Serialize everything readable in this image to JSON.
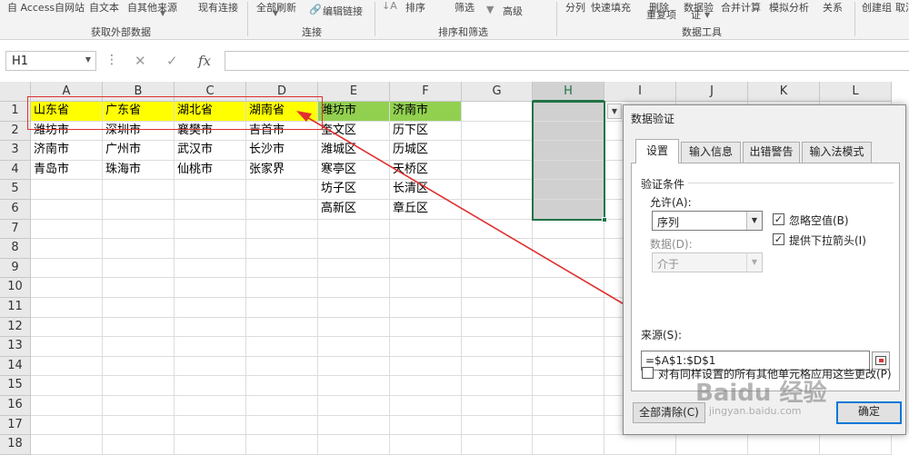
{
  "ribbon": {
    "top_items": [
      "自 Access",
      "自网站",
      "自文本",
      "自其他来源",
      "现有连接",
      "全部刷新",
      "编辑链接",
      "排序",
      "筛选",
      "高级",
      "分列",
      "快速填充",
      "删除",
      "数据验",
      "合并计算",
      "模拟分析",
      "关系",
      "创建组",
      "取消"
    ],
    "row2_items": [
      "重复项",
      "证"
    ],
    "groups": [
      "获取外部数据",
      "连接",
      "排序和筛选",
      "数据工具"
    ]
  },
  "formula_bar": {
    "name_box": "H1",
    "cancel_icon": "✕",
    "enter_icon": "✓",
    "fx_label": "fx",
    "value": ""
  },
  "sheet": {
    "columns": [
      "A",
      "B",
      "C",
      "D",
      "E",
      "F",
      "G",
      "H",
      "I",
      "J",
      "K",
      "L"
    ],
    "selected_column": "H",
    "rows": [
      "1",
      "2",
      "3",
      "4",
      "5",
      "6",
      "7",
      "8",
      "9",
      "10",
      "11",
      "12",
      "13",
      "14",
      "15",
      "16",
      "17",
      "18"
    ],
    "cells": {
      "A1": "山东省",
      "B1": "广东省",
      "C1": "湖北省",
      "D1": "湖南省",
      "E1": "潍坊市",
      "F1": "济南市",
      "A2": "潍坊市",
      "B2": "深圳市",
      "C2": "襄樊市",
      "D2": "吉首市",
      "E2": "奎文区",
      "F2": "历下区",
      "A3": "济南市",
      "B3": "广州市",
      "C3": "武汉市",
      "D3": "长沙市",
      "E3": "潍城区",
      "F3": "历城区",
      "A4": "青岛市",
      "B4": "珠海市",
      "C4": "仙桃市",
      "D4": "张家界",
      "E4": "寒亭区",
      "F4": "天桥区",
      "E5": "坊子区",
      "F5": "长清区",
      "E6": "高新区",
      "F6": "章丘区"
    },
    "colors": {
      "header_fill": "#ffff00",
      "city_header_fill": "#92d050",
      "selection_fill": "#d0d0d0",
      "selection_border": "#217346",
      "annotation": "#e03030"
    }
  },
  "dialog": {
    "title": "数据验证",
    "tabs": [
      "设置",
      "输入信息",
      "出错警告",
      "输入法模式"
    ],
    "active_tab": "设置",
    "section_label": "验证条件",
    "allow_label": "允许(A):",
    "allow_value": "序列",
    "ignore_blank_label": "忽略空值(B)",
    "ignore_blank_checked": true,
    "dropdown_label": "提供下拉箭头(I)",
    "dropdown_checked": true,
    "data_label": "数据(D):",
    "data_value": "介于",
    "source_label": "来源(S):",
    "source_value": "=$A$1:$D$1",
    "apply_all_label": "对有同样设置的所有其他单元格应用这些更改(P)",
    "apply_all_checked": false,
    "clear_button": "全部清除(C)",
    "ok_button": "确定"
  },
  "watermark": {
    "text": "Baidu 经验",
    "sub": "jingyan.baidu.com"
  }
}
